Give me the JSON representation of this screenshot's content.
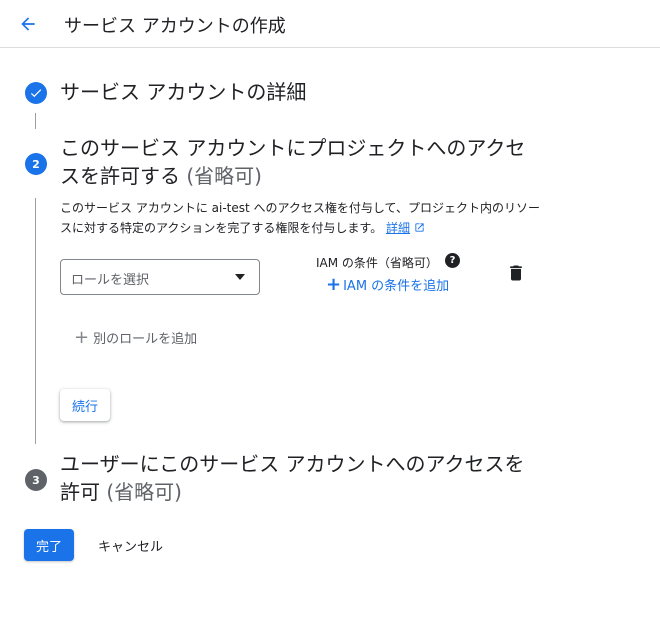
{
  "header": {
    "title": "サービス アカウントの作成",
    "back_icon": "arrow-back-icon"
  },
  "steps": [
    {
      "status": "completed",
      "icon": "check-icon",
      "title": "サービス アカウントの詳細"
    },
    {
      "status": "active",
      "number": "2",
      "title": "このサービス アカウントにプロジェクトへのアクセスを許可する",
      "optional": "(省略可)",
      "description": "このサービス アカウントに ai-test へのアクセス権を付与して、プロジェクト内のリソースに対する特定のアクションを完了する権限を付与します。",
      "details_link": "詳細",
      "role_select_placeholder": "ロールを選択",
      "iam_condition_label": "IAM の条件（省略可）",
      "add_iam_condition": "IAM の条件を追加",
      "add_role": "別のロールを追加",
      "continue": "続行"
    },
    {
      "status": "pending",
      "number": "3",
      "title": "ユーザーにこのサービス アカウントへのアクセスを許可",
      "optional": "(省略可)"
    }
  ],
  "footer": {
    "done": "完了",
    "cancel": "キャンセル"
  },
  "colors": {
    "primary": "#1a73e8",
    "inactive_step": "#5f6368",
    "text": "#202124"
  }
}
